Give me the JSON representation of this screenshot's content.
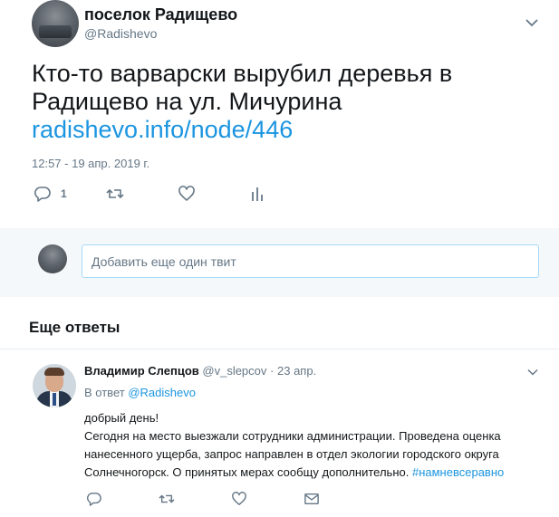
{
  "tweet": {
    "author_name": "поселок Радищево",
    "author_handle": "@Radishevo",
    "text_line1": "Кто-то варварски вырубил деревья в",
    "text_line2": "Радищево на ул. Мичурина",
    "link": "radishevo.info/node/446",
    "timestamp": "12:57 - 19 апр. 2019 г.",
    "actions": {
      "reply_count": "1",
      "icons": [
        "reply-icon",
        "retweet-icon",
        "like-icon",
        "analytics-icon"
      ]
    }
  },
  "compose": {
    "placeholder": "Добавить еще один твит"
  },
  "more_replies": {
    "title": "Еще ответы"
  },
  "reply": {
    "author_name": "Владимир Слепцов",
    "author_handle": "@v_slepcov",
    "separator": "·",
    "date": "23 апр.",
    "in_reply_prefix": "В ответ",
    "in_reply_to": "@Radishevo",
    "body_line1": "добрый день!",
    "body_line2": "Сегодня на место выезжали сотрудники администрации. Проведена оценка",
    "body_line3": "нанесенного ущерба, запрос направлен в отдел экологии городского округа",
    "body_line4_text": "Солнечногорск. О принятых мерах сообщу дополнительно.",
    "hashtag": "#намневсеравно",
    "icons": [
      "reply-icon",
      "retweet-icon",
      "like-icon",
      "message-icon"
    ]
  },
  "colors": {
    "link": "#1b95e0",
    "muted": "#657786",
    "text": "#14171a",
    "compose_bg": "#f5f8fa",
    "input_border": "#a4d9f9"
  }
}
